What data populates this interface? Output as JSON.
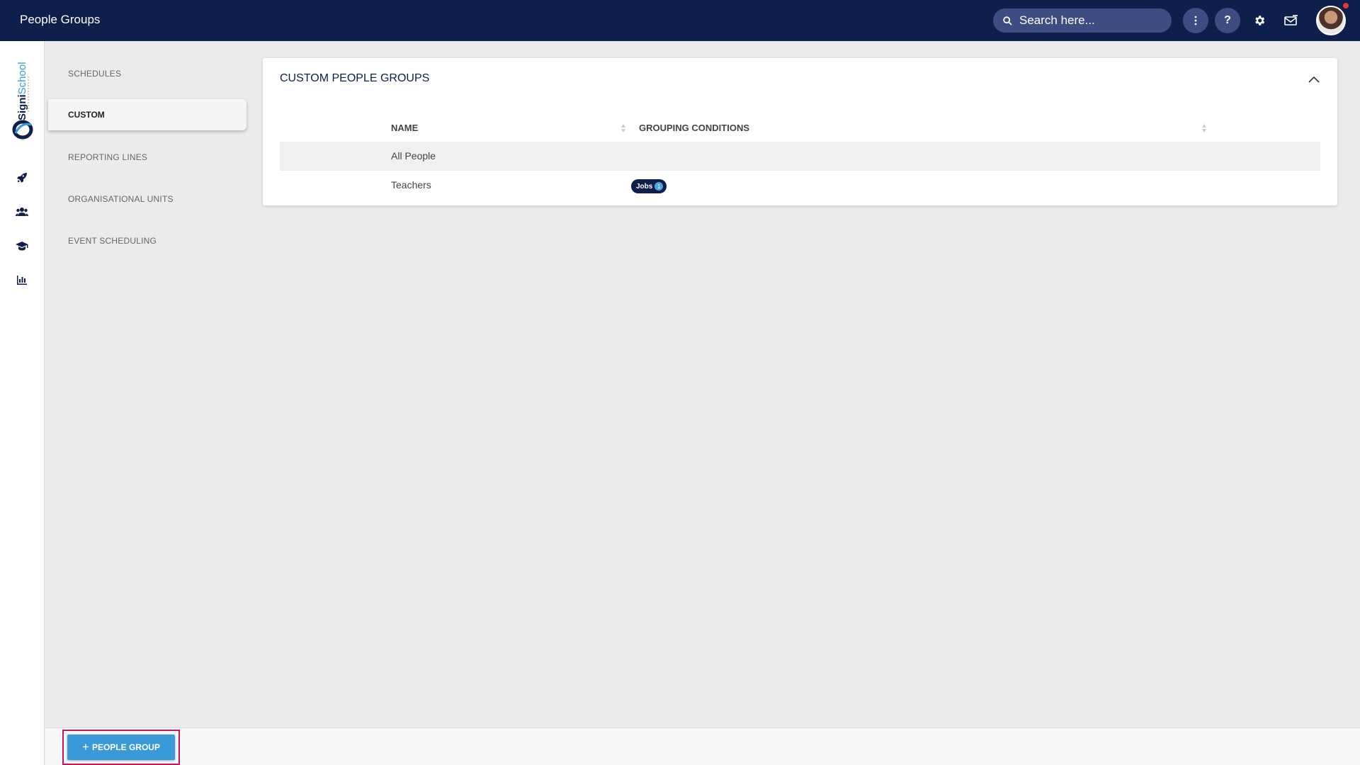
{
  "header": {
    "title": "People Groups",
    "search_placeholder": "Search here..."
  },
  "sidebar": {
    "logo_text": "SigniSchool",
    "icons": [
      "rocket-icon",
      "people-icon",
      "graduation-cap-icon",
      "bar-chart-icon"
    ]
  },
  "subnav": {
    "items": [
      {
        "label": "SCHEDULES",
        "active": false
      },
      {
        "label": "CUSTOM",
        "active": true
      },
      {
        "label": "REPORTING LINES",
        "active": false
      },
      {
        "label": "ORGANISATIONAL UNITS",
        "active": false
      },
      {
        "label": "EVENT SCHEDULING",
        "active": false
      }
    ]
  },
  "card": {
    "title": "CUSTOM PEOPLE GROUPS",
    "columns": [
      "NAME",
      "GROUPING CONDITIONS"
    ],
    "rows": [
      {
        "name": "All People",
        "conditions": []
      },
      {
        "name": "Teachers",
        "conditions": [
          {
            "label": "Jobs",
            "count": "1"
          }
        ]
      }
    ]
  },
  "footer": {
    "add_button_label": "PEOPLE GROUP"
  },
  "colors": {
    "topbar": "#0f1f4b",
    "accent": "#3a9ad9",
    "highlight_border": "#c2185b"
  }
}
